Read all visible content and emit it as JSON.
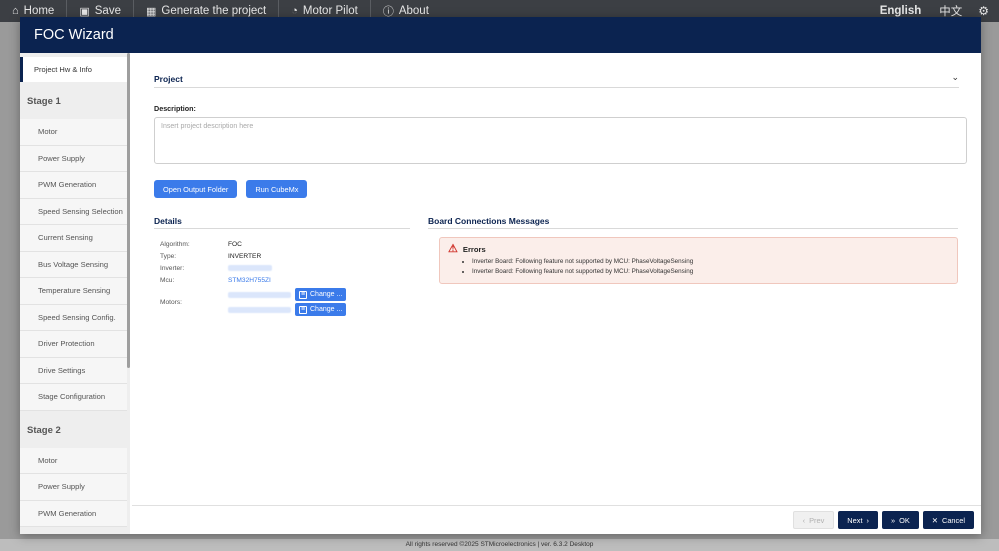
{
  "topbar": {
    "home": "Home",
    "save": "Save",
    "generate": "Generate the project",
    "motor_pilot": "Motor Pilot",
    "about": "About",
    "lang_en": "English",
    "lang_zh": "中文"
  },
  "modal": {
    "title": "FOC Wizard"
  },
  "sidebar": {
    "top_item": "Project Hw & Info",
    "stage1_title": "Stage 1",
    "stage1_items": [
      "Motor",
      "Power Supply",
      "PWM Generation",
      "Speed Sensing Selection",
      "Current Sensing",
      "Bus Voltage Sensing",
      "Temperature Sensing",
      "Speed Sensing Config.",
      "Driver Protection",
      "Drive Settings",
      "Stage Configuration"
    ],
    "stage2_title": "Stage 2",
    "stage2_items": [
      "Motor",
      "Power Supply",
      "PWM Generation"
    ]
  },
  "project": {
    "section_title": "Project",
    "description_label": "Description:",
    "description_placeholder": "Insert project description here",
    "description_value": "",
    "open_folder": "Open Output Folder",
    "run_cubemx": "Run CubeMx"
  },
  "details": {
    "title": "Details",
    "algorithm_label": "Algorithm:",
    "algorithm_value": "FOC",
    "type_label": "Type:",
    "type_value": "INVERTER",
    "inverter_label": "Inverter:",
    "mcu_label": "Mcu:",
    "mcu_value": "STM32H755ZI",
    "motors_label": "Motors:",
    "change_label": "Change ..."
  },
  "board_messages": {
    "title": "Board Connections Messages",
    "errors_title": "Errors",
    "errors": [
      "Inverter Board: Following feature not supported by MCU: PhaseVoltageSensing",
      "Inverter Board: Following feature not supported by MCU: PhaseVoltageSensing"
    ]
  },
  "bottom": {
    "prev": "Prev",
    "next": "Next",
    "ok": "OK",
    "cancel": "Cancel"
  },
  "footer": "All rights reserved ©2025 STMicroelectronics | ver. 6.3.2 Desktop",
  "colors": {
    "header_navy": "#0b2350",
    "accent_blue": "#3b7bea",
    "error_red": "#d0342c"
  }
}
